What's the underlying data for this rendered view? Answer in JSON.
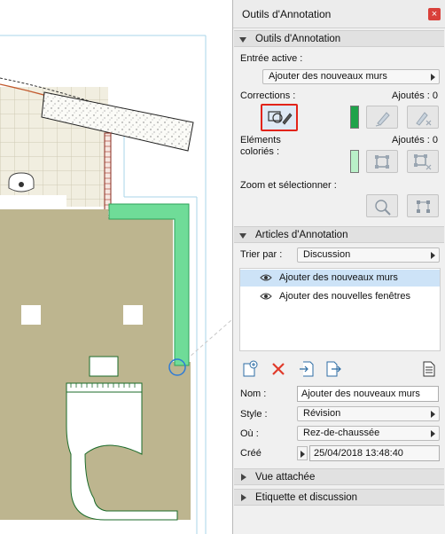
{
  "palette": {
    "title": "Outils d'Annotation",
    "close_glyph": "×",
    "sections": {
      "tools": "Outils d'Annotation",
      "items": "Articles d'Annotation",
      "attached_view": "Vue attachée",
      "tag_discussion": "Etiquette et discussion"
    },
    "active_entry": {
      "label": "Entrée active :",
      "value": "Ajouter des nouveaux murs"
    },
    "corrections": {
      "label": "Corrections :",
      "added": "Ajoutés : 0",
      "swatch_color": "#1fa34a"
    },
    "highlighted": {
      "label_line1": "Eléments",
      "label_line2": "coloriés :",
      "added": "Ajoutés : 0",
      "swatch_color": "#b9f0c8"
    },
    "zoom": {
      "label": "Zoom et sélectionner :"
    },
    "sort": {
      "label": "Trier par :",
      "value": "Discussion"
    },
    "items": [
      {
        "label": "Ajouter des nouveaux murs",
        "selected": true
      },
      {
        "label": "Ajouter des nouvelles  fenêtres",
        "selected": false
      }
    ],
    "details": {
      "name_label": "Nom :",
      "name_value": "Ajouter des nouveaux murs",
      "style_label": "Style :",
      "style_value": "Révision",
      "where_label": "Où :",
      "where_value": "Rez-de-chaussée",
      "created_label": "Créé",
      "created_value": "25/04/2018 13:48:40"
    },
    "colors": {
      "accent_red": "#e2231a",
      "selection_blue": "#cde3f7",
      "delete_red": "#e03a2a"
    },
    "icons": {
      "new": "new-item-icon",
      "delete": "delete-icon",
      "import": "import-icon",
      "export": "export-icon",
      "document": "document-icon"
    }
  },
  "canvas": {
    "floor_color": "#bdb58f",
    "new_wall_color": "#6fdc98",
    "marker_color": "#2e7bd6"
  }
}
